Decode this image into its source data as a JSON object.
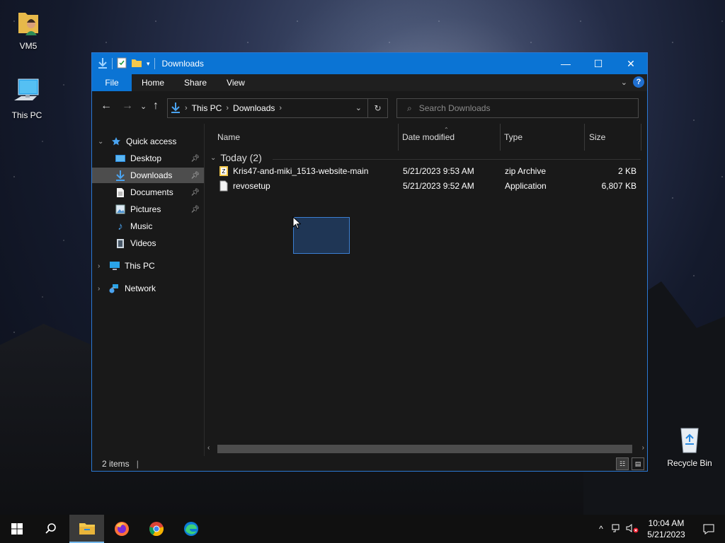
{
  "desktop": {
    "icons": [
      {
        "label": "VM5",
        "icon": "user-folder-icon"
      },
      {
        "label": "This PC",
        "icon": "computer-icon"
      },
      {
        "label": "Recycle Bin",
        "icon": "recycle-bin-icon"
      }
    ]
  },
  "window": {
    "title": "Downloads",
    "controls": {
      "minimize": "—",
      "maximize": "☐",
      "close": "✕"
    },
    "ribbon": {
      "tabs": [
        "File",
        "Home",
        "Share",
        "View"
      ],
      "help_label": "?"
    },
    "address": {
      "crumbs": [
        "This PC",
        "Downloads"
      ],
      "search_placeholder": "Search Downloads"
    },
    "nav": {
      "quick_access": "Quick access",
      "items": [
        {
          "label": "Desktop",
          "pinned": true
        },
        {
          "label": "Downloads",
          "pinned": true,
          "selected": true
        },
        {
          "label": "Documents",
          "pinned": true
        },
        {
          "label": "Pictures",
          "pinned": true
        },
        {
          "label": "Music",
          "pinned": false
        },
        {
          "label": "Videos",
          "pinned": false
        }
      ],
      "this_pc": "This PC",
      "network": "Network"
    },
    "columns": [
      "Name",
      "Date modified",
      "Type",
      "Size"
    ],
    "group": "Today (2)",
    "files": [
      {
        "name": "Kris47-and-miki_1513-website-main",
        "date": "5/21/2023 9:53 AM",
        "type": "zip Archive",
        "size": "2 KB",
        "icon": "zip-icon"
      },
      {
        "name": "revosetup",
        "date": "5/21/2023 9:52 AM",
        "type": "Application",
        "size": "6,807 KB",
        "icon": "application-icon"
      }
    ],
    "status": "2 items"
  },
  "taskbar": {
    "apps": [
      "start-icon",
      "search-icon",
      "file-explorer-icon",
      "firefox-icon",
      "chrome-icon",
      "edge-icon"
    ],
    "time": "10:04 AM",
    "date": "5/21/2023"
  },
  "colors": {
    "accent": "#0b74d4",
    "window_bg": "#191919",
    "selection": "#4d4d4d",
    "taskbar": "#101010"
  }
}
